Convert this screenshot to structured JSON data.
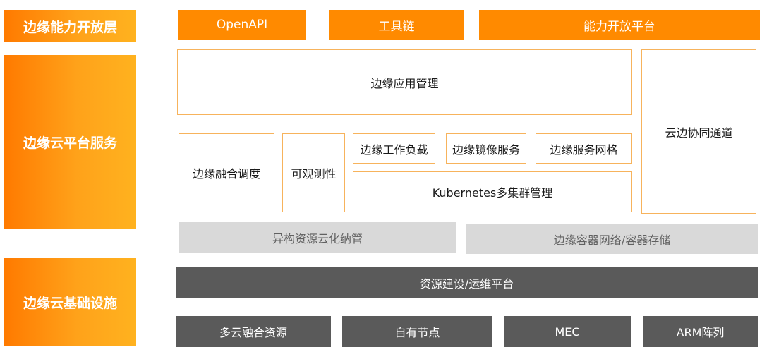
{
  "layers": {
    "open": "边缘能力开放层",
    "platform": "边缘云平台服务",
    "infra": "边缘云基础设施"
  },
  "open_layer": {
    "openapi": "OpenAPI",
    "toolchain": "工具链",
    "capability_platform": "能力开放平台"
  },
  "platform_layer": {
    "app_management": "边缘应用管理",
    "cloud_edge_channel": "云边协同通道",
    "fusion_scheduling": "边缘融合调度",
    "observability": "可观测性",
    "edge_workload": "边缘工作负载",
    "edge_image_service": "边缘镜像服务",
    "edge_service_mesh": "边缘服务网格",
    "k8s_multicluster": "Kubernetes多集群管理",
    "heterogeneous": "异构资源云化纳管",
    "network_storage": "边缘容器网络/容器存储"
  },
  "infra_layer": {
    "ops_platform": "资源建设/运维平台",
    "multicloud": "多云融合资源",
    "own_nodes": "自有节点",
    "mec": "MEC",
    "arm": "ARM阵列"
  }
}
